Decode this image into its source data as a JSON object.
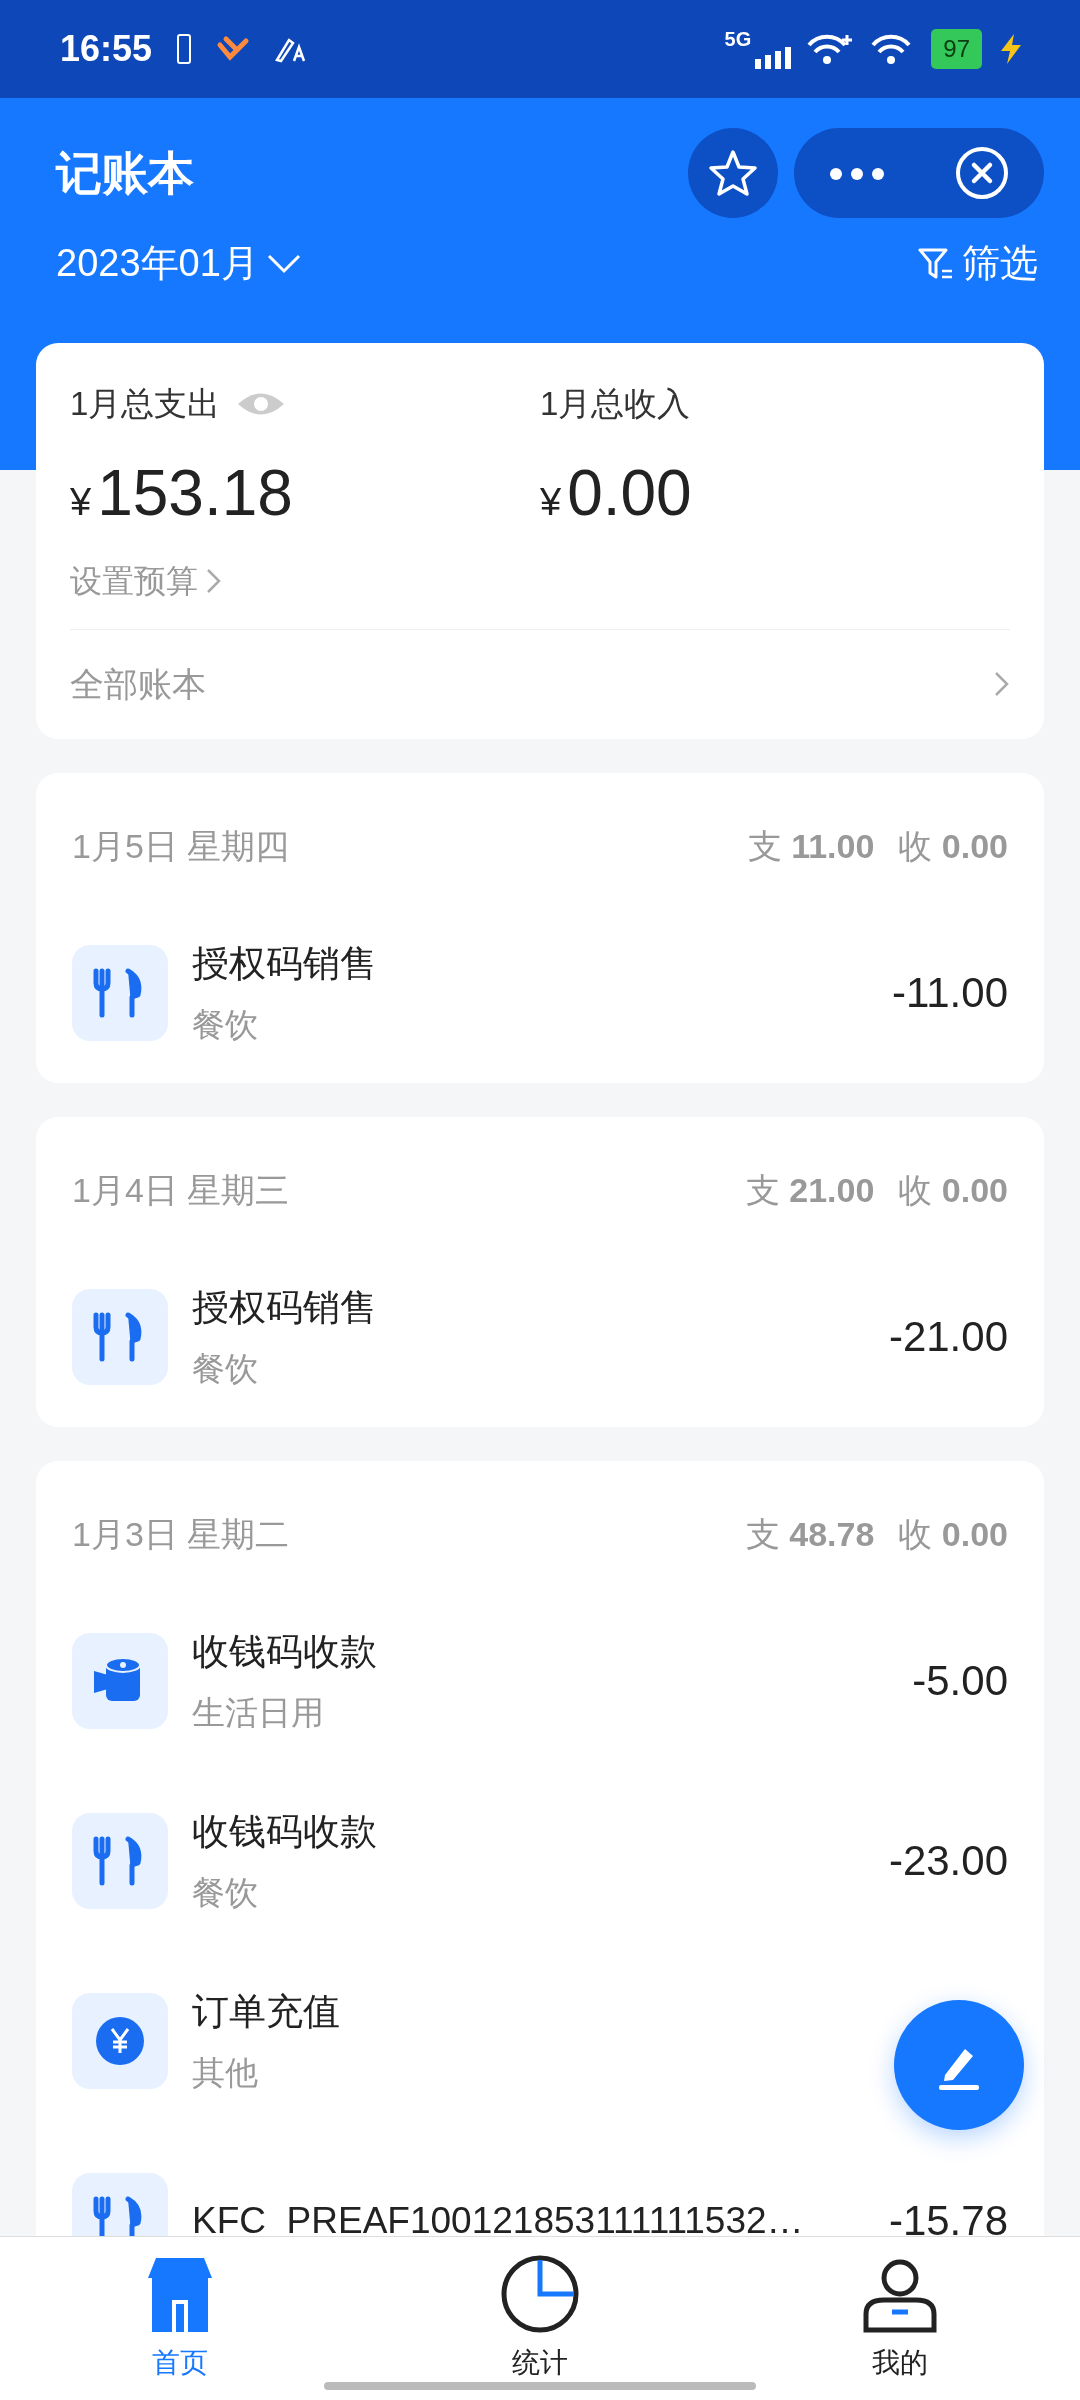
{
  "status_bar": {
    "time": "16:55",
    "network": "5G",
    "battery": "97",
    "charging": true
  },
  "header": {
    "title": "记账本",
    "month": "2023年01月",
    "filter": "筛选"
  },
  "summary": {
    "expense_label": "1月总支出",
    "expense_symbol": "¥",
    "expense": "153.18",
    "income_label": "1月总收入",
    "income_symbol": "¥",
    "income": "0.00",
    "budget_link": "设置预算",
    "books_link": "全部账本"
  },
  "days": [
    {
      "date": "1月5日 星期四",
      "expense_label": "支",
      "expense": "11.00",
      "income_label": "收",
      "income": "0.00",
      "entries": [
        {
          "kind": "food",
          "title": "授权码销售",
          "category": "餐饮",
          "amount": "-11.00"
        }
      ]
    },
    {
      "date": "1月4日 星期三",
      "expense_label": "支",
      "expense": "21.00",
      "income_label": "收",
      "income": "0.00",
      "entries": [
        {
          "kind": "food",
          "title": "授权码销售",
          "category": "餐饮",
          "amount": "-21.00"
        }
      ]
    },
    {
      "date": "1月3日 星期二",
      "expense_label": "支",
      "expense": "48.78",
      "income_label": "收",
      "income": "0.00",
      "entries": [
        {
          "kind": "daily",
          "title": "收钱码收款",
          "category": "生活日用",
          "amount": "-5.00"
        },
        {
          "kind": "food",
          "title": "收钱码收款",
          "category": "餐饮",
          "amount": "-23.00"
        },
        {
          "kind": "other",
          "title": "订单充值",
          "category": "其他"
        },
        {
          "kind": "food",
          "title": "KFC_PREAF100121853111111532…",
          "amount": "-15.78"
        }
      ]
    }
  ],
  "nav": [
    {
      "kind": "home",
      "label": "首页",
      "selected": true
    },
    {
      "kind": "stats",
      "label": "统计",
      "selected": false
    },
    {
      "kind": "mine",
      "label": "我的",
      "selected": false
    }
  ]
}
